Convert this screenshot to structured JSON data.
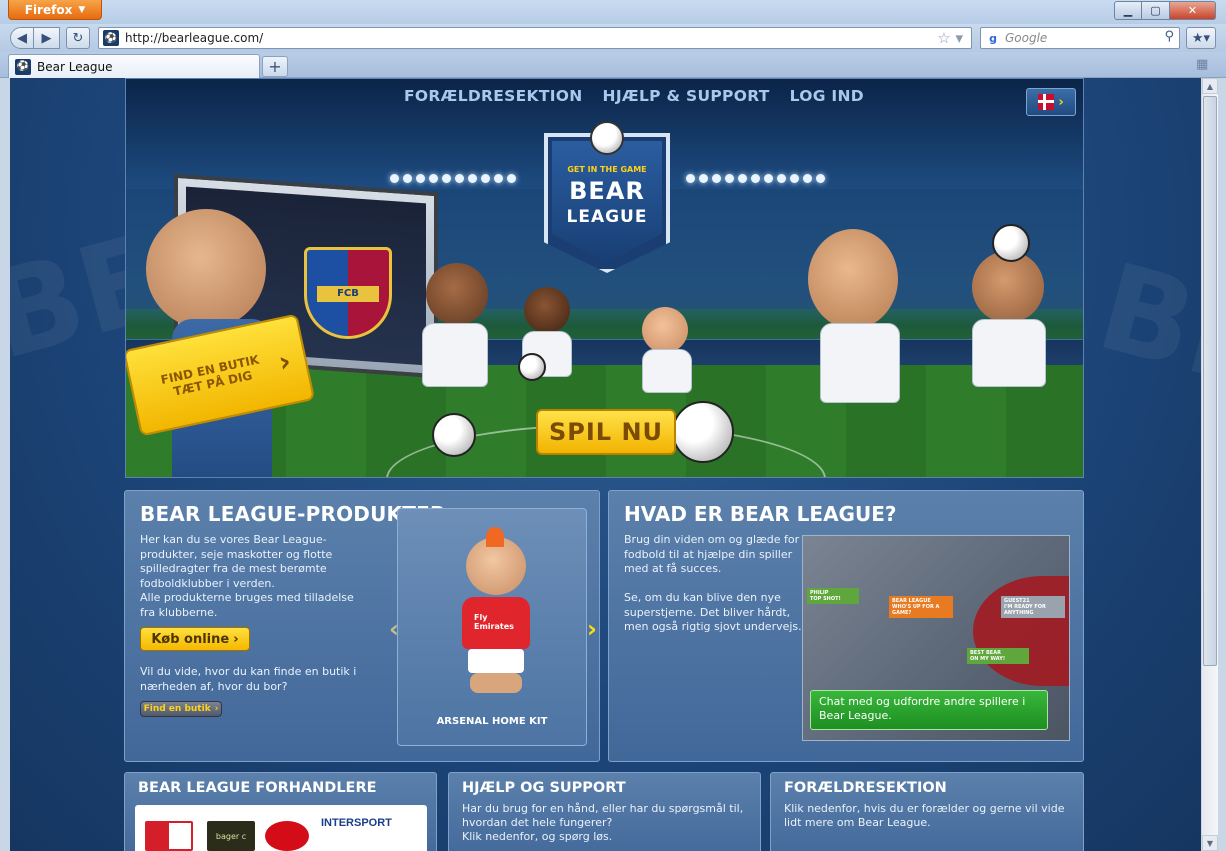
{
  "browser": {
    "menu_button": "Firefox",
    "url": "http://bearleague.com/",
    "search_placeholder": "Google",
    "tab_title": "Bear League",
    "new_tab": "+"
  },
  "hero": {
    "nav": [
      {
        "label": "FORÆLDRESEKTION"
      },
      {
        "label": "HJÆLP & SUPPORT"
      },
      {
        "label": "LOG IND"
      }
    ],
    "logo_tagline": "GET IN THE GAME",
    "logo_word1": "BEAR",
    "logo_word2": "LEAGUE",
    "crest_text": "FCB",
    "find_store": "FIND EN BUTIK TÆT PÅ DIG",
    "play": "SPIL NU"
  },
  "products": {
    "title": "BEAR LEAGUE-PRODUKTER",
    "desc": "Her kan du se vores Bear League-produkter, seje maskotter og flotte spilledragter fra de mest berømte fodboldklubber i verden.\nAlle produkterne bruges med tilladelse fra klubberne.",
    "buy_label": "Køb online",
    "question": "Vil du vide, hvor du kan finde en butik i nærheden af, hvor du bor?",
    "find_small": "Find en butik",
    "product_name": "ARSENAL HOME KIT",
    "shirt_text": "Fly Emirates"
  },
  "what": {
    "title": "HVAD ER BEAR LEAGUE?",
    "p1": "Brug din viden om og glæde for fodbold til at hjælpe din spiller med at få succes.",
    "p2": "Se, om du kan blive den nye superstjerne. Det bliver hårdt, men også rigtig sjovt undervejs.",
    "chat": "Chat med og udfordre andre spillere i Bear League.",
    "bubbles": [
      {
        "text": "PHILIP\nTOP SHOT!"
      },
      {
        "text": "BEAR LEAGUE\nWHO'S UP FOR A GAME?"
      },
      {
        "text": "GUEST21\nI'M READY FOR ANYTHING"
      },
      {
        "text": "BEST BEAR\nON MY WAY!"
      }
    ]
  },
  "dealers": {
    "title": "BEAR LEAGUE FORHANDLERE",
    "logos": [
      {
        "name": "dealer-logo-1"
      },
      {
        "name": "bager-logo",
        "text": "bager c"
      },
      {
        "name": "dealer-logo-3"
      },
      {
        "name": "intersport-logo",
        "text": "INTERSPORT"
      }
    ]
  },
  "help": {
    "title": "HJÆLP OG SUPPORT",
    "text": "Har du brug for en hånd, eller har du spørgsmål til, hvordan det hele fungerer?\nKlik nedenfor, og spørg løs."
  },
  "parents": {
    "title": "FORÆLDRESEKTION",
    "text": "Klik nedenfor, hvis du er forælder og gerne vil vide lidt mere om Bear League."
  },
  "colors": {
    "brand_blue": "#1c4477",
    "accent_yellow": "#ffd21a",
    "chat_green": "#1e8f22"
  }
}
